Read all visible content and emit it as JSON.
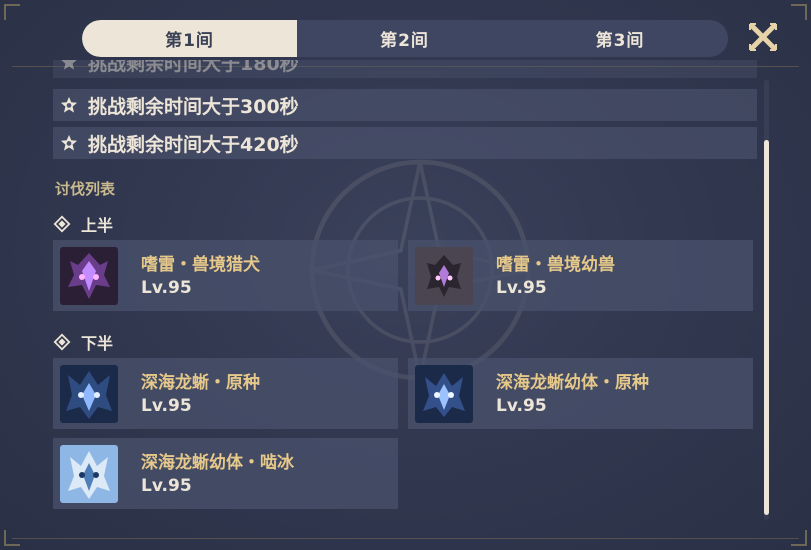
{
  "tabs": [
    {
      "label": "第1间",
      "active": true
    },
    {
      "label": "第2间",
      "active": false
    },
    {
      "label": "第3间",
      "active": false
    }
  ],
  "conditions": [
    {
      "text": "挑战剩余时间大于180秒",
      "partial": true
    },
    {
      "text": "挑战剩余时间大于300秒",
      "partial": false
    },
    {
      "text": "挑战剩余时间大于420秒",
      "partial": false
    }
  ],
  "list_title": "讨伐列表",
  "first_half": {
    "title": "上半",
    "enemies": [
      {
        "name": "嗜雷・兽境猎犬",
        "level": "Lv.95",
        "icon": "rifthound-electro-icon"
      },
      {
        "name": "嗜雷・兽境幼兽",
        "level": "Lv.95",
        "icon": "rifthound-whelp-electro-icon"
      }
    ]
  },
  "second_half": {
    "title": "下半",
    "enemies": [
      {
        "name": "深海龙蜥・原种",
        "level": "Lv.95",
        "icon": "bathysmal-vishap-icon"
      },
      {
        "name": "深海龙蜥幼体・原种",
        "level": "Lv.95",
        "icon": "bathysmal-vishap-hatchling-icon"
      },
      {
        "name": "深海龙蜥幼体・啮冰",
        "level": "Lv.95",
        "icon": "bathysmal-vishap-hatchling-cryo-icon"
      }
    ]
  },
  "colors": {
    "background": "#323850",
    "tab_active_bg": "#ece5d8",
    "enemy_name": "#e6c98a",
    "section_title": "#c9b98e",
    "text_light": "#ece5d8"
  }
}
